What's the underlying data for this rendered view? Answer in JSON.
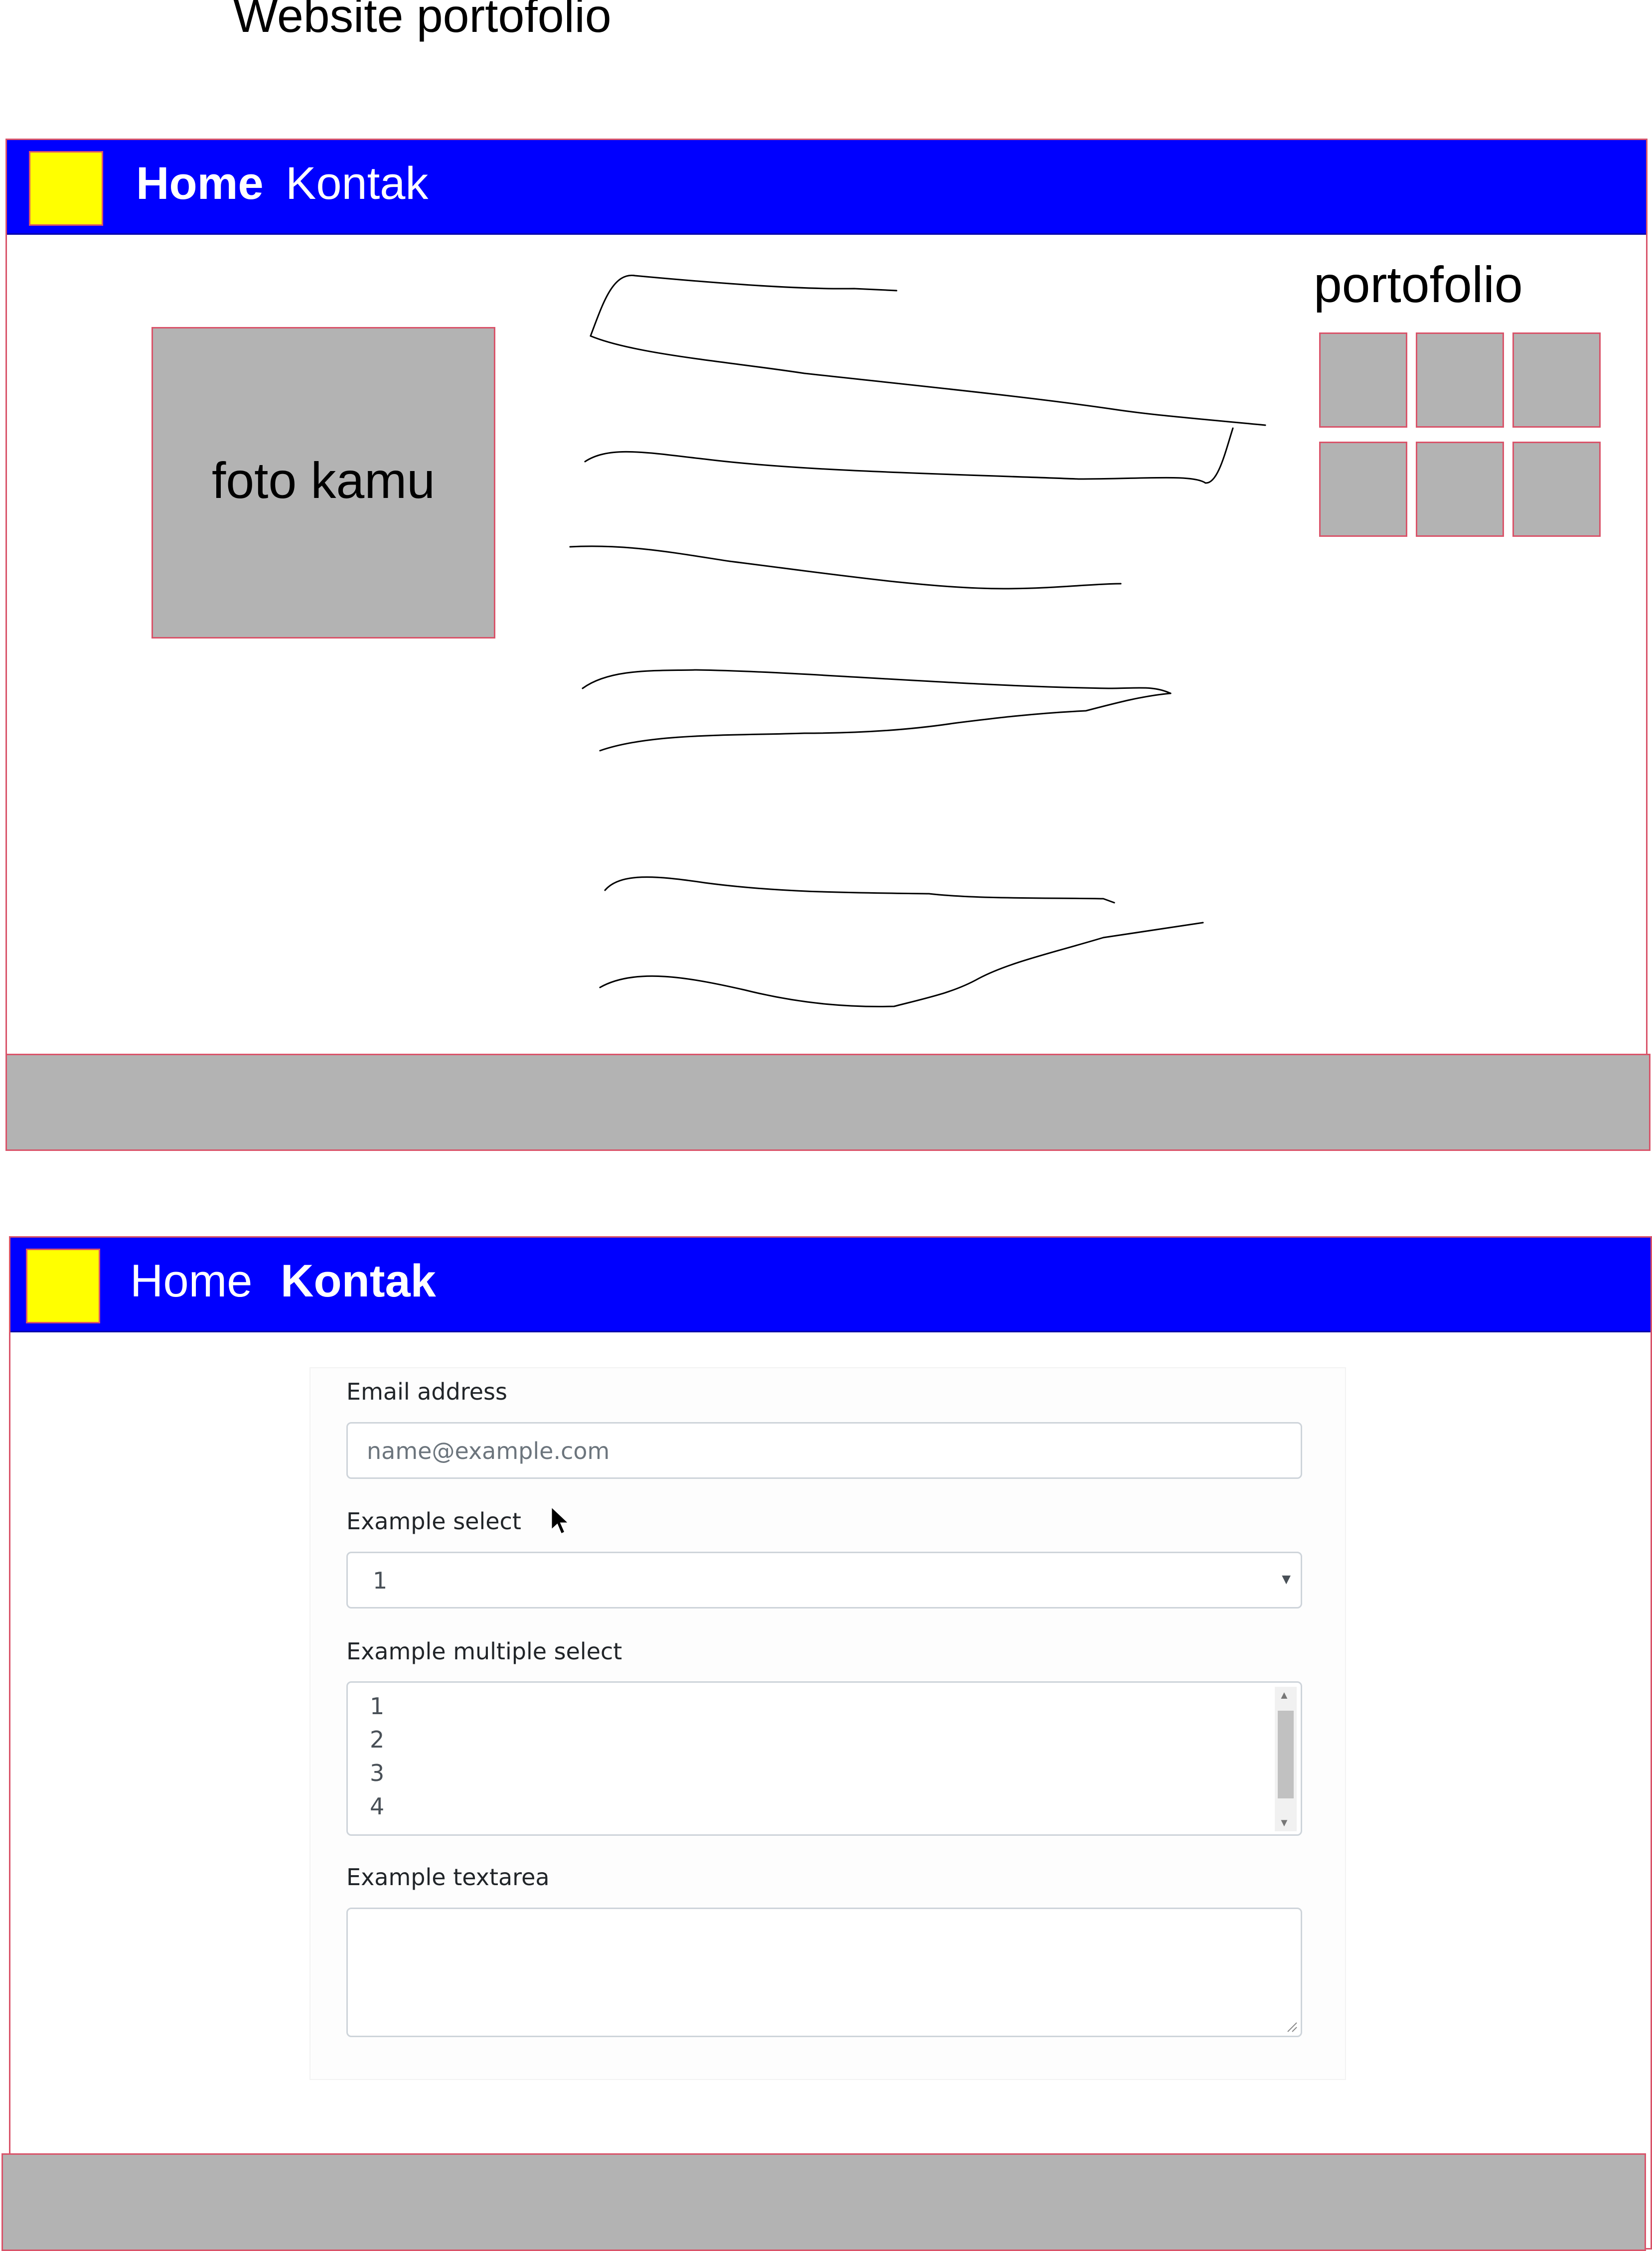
{
  "page_title": "Website portofolio",
  "colors": {
    "navbar": "#0000ff",
    "logo": "#ffff00",
    "placeholder_gray": "#b3b3b3",
    "frame_border": "#d9546a",
    "nav_text": "#ffffff"
  },
  "home_mockup": {
    "nav": {
      "logo_icon": "square-logo-icon",
      "home_label": "Home",
      "kontak_label": "Kontak",
      "active": "Home"
    },
    "photo_label": "foto kamu",
    "text_placeholder_icon": "scribble-lines-icon",
    "portfolio": {
      "heading": "portofolio",
      "thumbnail_count": 6
    }
  },
  "contact_mockup": {
    "nav": {
      "logo_icon": "square-logo-icon",
      "home_label": "Home",
      "kontak_label": "Kontak",
      "active": "Kontak"
    },
    "form": {
      "email": {
        "label": "Email address",
        "placeholder": "name@example.com"
      },
      "select": {
        "label": "Example select",
        "value": "1"
      },
      "multi_select": {
        "label": "Example multiple select",
        "visible_options": [
          "1",
          "2",
          "3",
          "4"
        ]
      },
      "textarea": {
        "label": "Example textarea",
        "value": ""
      }
    }
  }
}
